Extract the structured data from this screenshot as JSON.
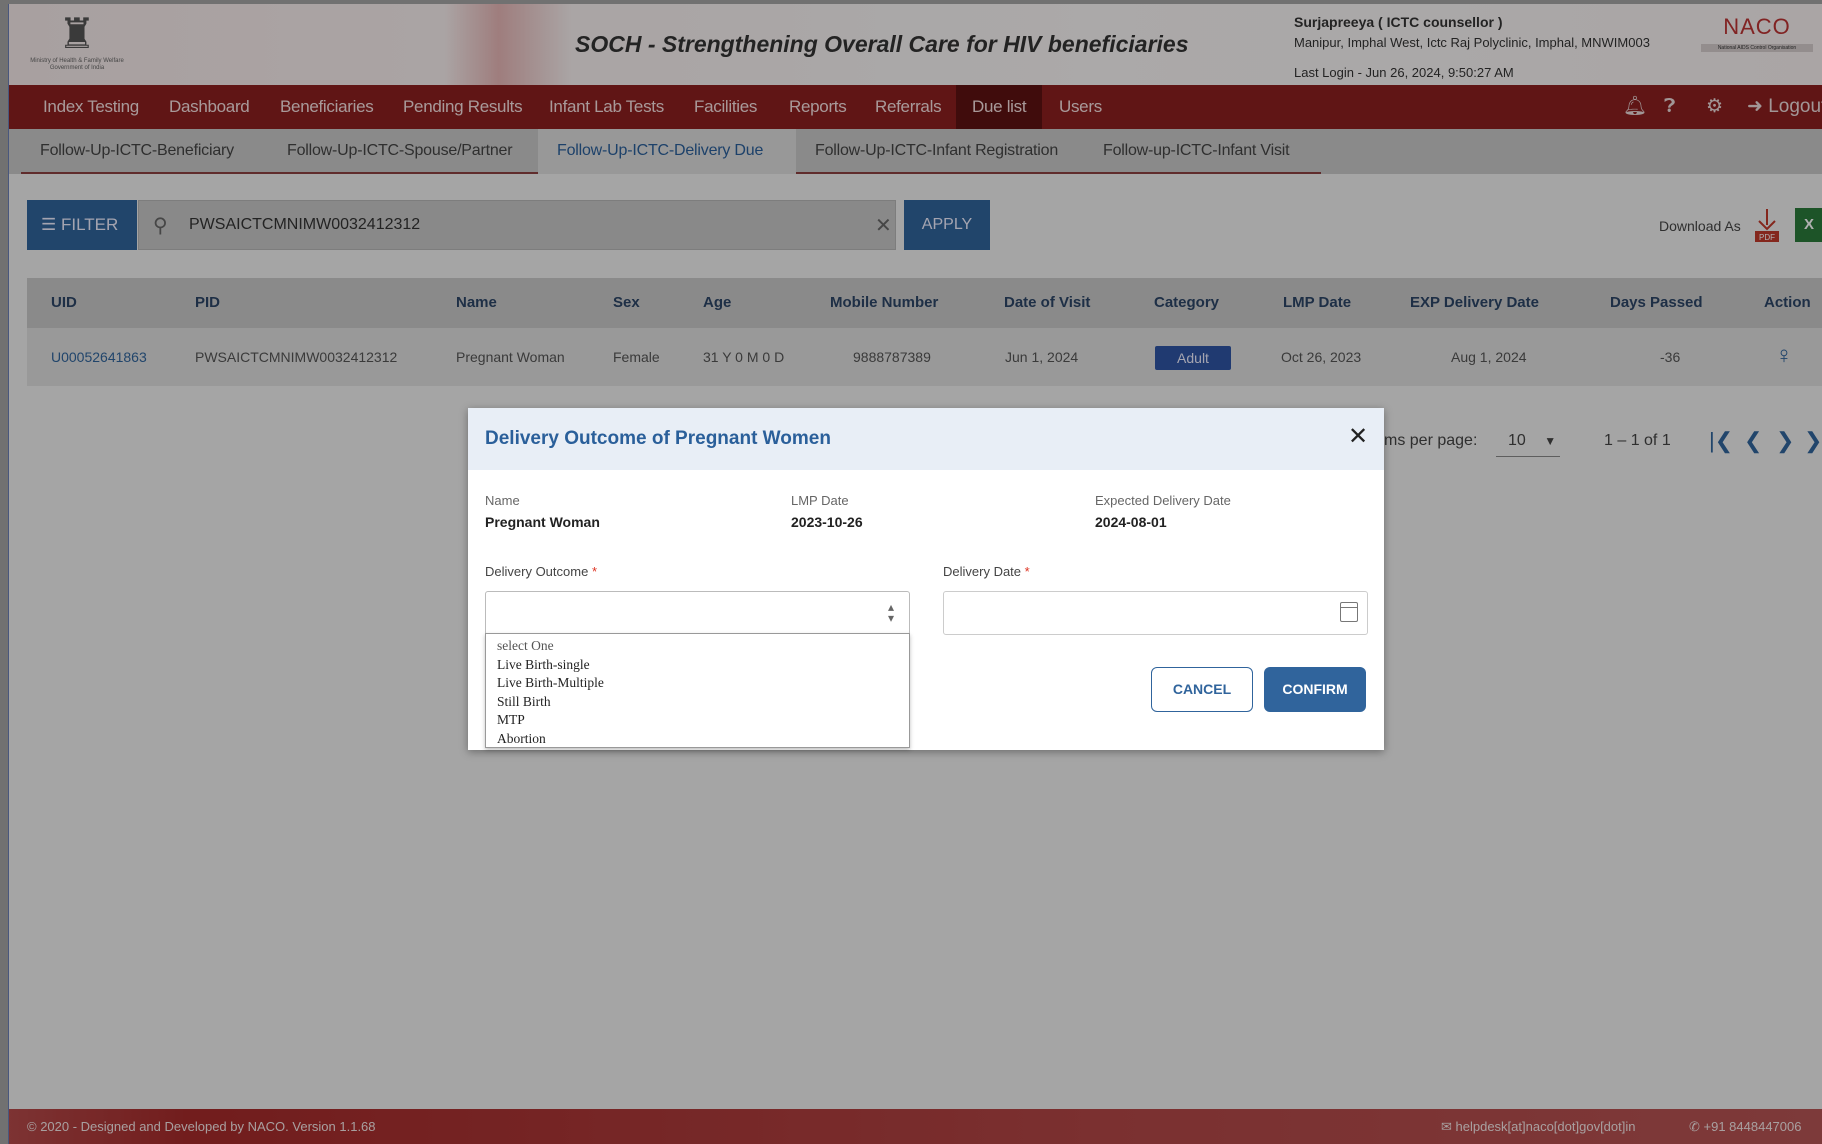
{
  "header": {
    "emblem_caption": "Ministry of Health & Family Welfare Government of India",
    "title": "SOCH - Strengthening Overall Care for HIV beneficiaries",
    "user_name": "Surjapreeya ( ICTC counsellor )",
    "user_location": "Manipur, Imphal West, Ictc Raj Polyclinic, Imphal, MNWIM003",
    "last_login": "Last Login - Jun 26, 2024, 9:50:27 AM",
    "logo_text": "NACO",
    "logo_subtext": "National AIDS Control Organisation"
  },
  "nav": {
    "items": [
      "Index Testing",
      "Dashboard",
      "Beneficiaries",
      "Pending Results",
      "Infant Lab Tests",
      "Facilities",
      "Reports",
      "Referrals",
      "Due list",
      "Users"
    ],
    "active": "Due list",
    "logout": "Logout"
  },
  "subtabs": {
    "items": [
      "Follow-Up-ICTC-Beneficiary",
      "Follow-Up-ICTC-Spouse/Partner",
      "Follow-Up-ICTC-Delivery Due",
      "Follow-Up-ICTC-Infant Registration",
      "Follow-up-ICTC-Infant Visit"
    ],
    "active": "Follow-Up-ICTC-Delivery Due"
  },
  "toolbar": {
    "filter_label": "FILTER",
    "search_value": "PWSAICTCMNIMW0032412312",
    "apply_label": "APPLY",
    "download_label": "Download As",
    "pdf_label": "PDF"
  },
  "table": {
    "headers": [
      "UID",
      "PID",
      "Name",
      "Sex",
      "Age",
      "Mobile Number",
      "Date of Visit",
      "Category",
      "LMP Date",
      "EXP Delivery Date",
      "Days Passed",
      "Action"
    ],
    "row": {
      "uid": "U00052641863",
      "pid": "PWSAICTCMNIMW0032412312",
      "name": "Pregnant Woman",
      "sex": "Female",
      "age": "31 Y 0 M 0 D",
      "mobile": "9888787389",
      "date_of_visit": "Jun 1, 2024",
      "category": "Adult",
      "lmp_date": "Oct 26, 2023",
      "exp_delivery_date": "Aug 1, 2024",
      "days_passed": "-36"
    }
  },
  "paginator": {
    "items_per_page_label": "ms per page:",
    "items_per_page": "10",
    "range": "1 – 1 of 1"
  },
  "dialog": {
    "title": "Delivery Outcome of Pregnant Women",
    "name_label": "Name",
    "name_value": "Pregnant Woman",
    "lmp_label": "LMP Date",
    "lmp_value": "2023-10-26",
    "edd_label": "Expected Delivery Date",
    "edd_value": "2024-08-01",
    "outcome_label": "Delivery Outcome",
    "date_label": "Delivery Date",
    "required_mark": "*",
    "outcome_options": [
      "select One",
      "Live Birth-single",
      "Live Birth-Multiple",
      "Still Birth",
      "MTP",
      "Abortion"
    ],
    "cancel_label": "CANCEL",
    "confirm_label": "CONFIRM"
  },
  "footer": {
    "copyright": "© 2020 - Designed and Developed by NACO. Version 1.1.68",
    "email": "helpdesk[at]naco[dot]gov[dot]in",
    "phone": "+91 8448447006"
  },
  "colors": {
    "nav_bg": "#8c1f1f",
    "primary": "#30649c",
    "badge": "#2f55a4",
    "footer_bg": "#a52a2a"
  }
}
